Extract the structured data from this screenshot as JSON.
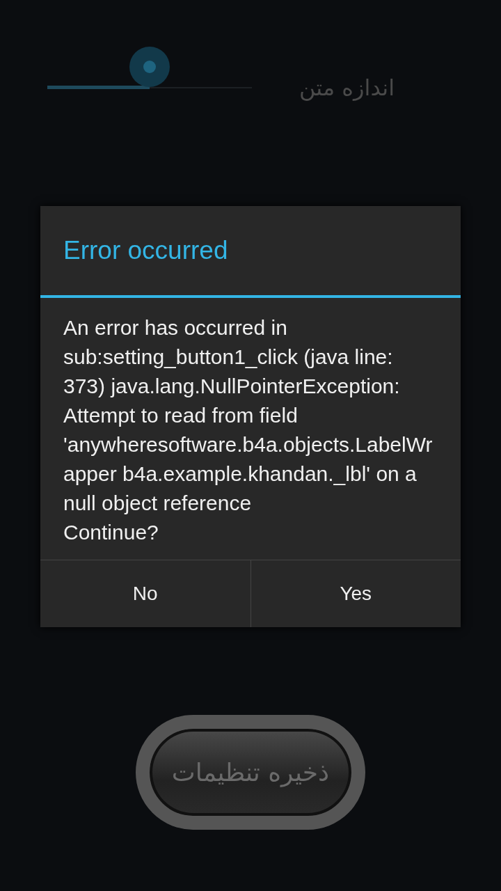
{
  "settings": {
    "text_size": {
      "label": "اندازه متن",
      "level": 0.5
    }
  },
  "save_button": {
    "label": "ذخیره تنظیمات"
  },
  "dialog": {
    "title": "Error occurred",
    "message": "An error has occurred in sub:setting_button1_click (java line: 373) java.lang.NullPointerException: Attempt to read from field 'anywheresoftware.b4a.objects.LabelWrapper b4a.example.khandan._lbl' on a null object reference",
    "question": "Continue?",
    "buttons": [
      {
        "label": "No"
      },
      {
        "label": "Yes"
      }
    ]
  }
}
